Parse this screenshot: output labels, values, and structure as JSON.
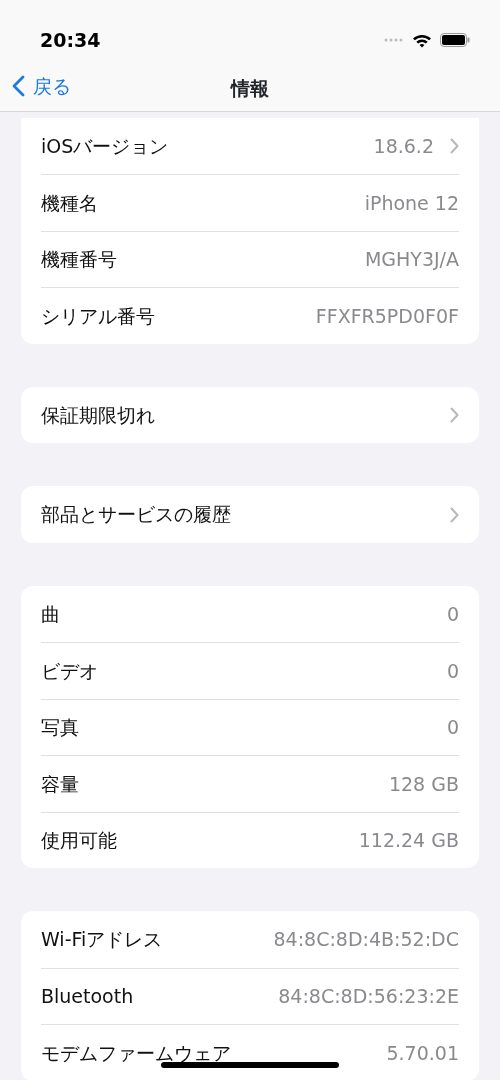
{
  "status_bar": {
    "time": "20:34"
  },
  "nav": {
    "back": "戻る",
    "title": "情報"
  },
  "groups": [
    {
      "cut_top": true,
      "rows": [
        {
          "label": "iOSバージョン",
          "value": "18.6.2",
          "chevron": true
        },
        {
          "label": "機種名",
          "value": "iPhone 12",
          "chevron": false
        },
        {
          "label": "機種番号",
          "value": "MGHY3J/A",
          "chevron": false
        },
        {
          "label": "シリアル番号",
          "value": "FFXFR5PD0F0F",
          "chevron": false
        }
      ]
    },
    {
      "cut_top": false,
      "rows": [
        {
          "label": "保証期限切れ",
          "chevron": true
        }
      ]
    },
    {
      "cut_top": false,
      "rows": [
        {
          "label": "部品とサービスの履歴",
          "chevron": true
        }
      ]
    },
    {
      "cut_top": false,
      "rows": [
        {
          "label": "曲",
          "value": "0",
          "chevron": false
        },
        {
          "label": "ビデオ",
          "value": "0",
          "chevron": false
        },
        {
          "label": "写真",
          "value": "0",
          "chevron": false
        },
        {
          "label": "容量",
          "value": "128 GB",
          "chevron": false
        },
        {
          "label": "使用可能",
          "value": "112.24 GB",
          "chevron": false
        }
      ]
    },
    {
      "cut_top": false,
      "rows": [
        {
          "label": "Wi-Fiアドレス",
          "value": "84:8C:8D:4B:52:DC",
          "chevron": false
        },
        {
          "label": "Bluetooth",
          "value": "84:8C:8D:56:23:2E",
          "chevron": false
        },
        {
          "label": "モデムファームウェア",
          "value": "5.70.01",
          "chevron": false
        }
      ]
    }
  ]
}
